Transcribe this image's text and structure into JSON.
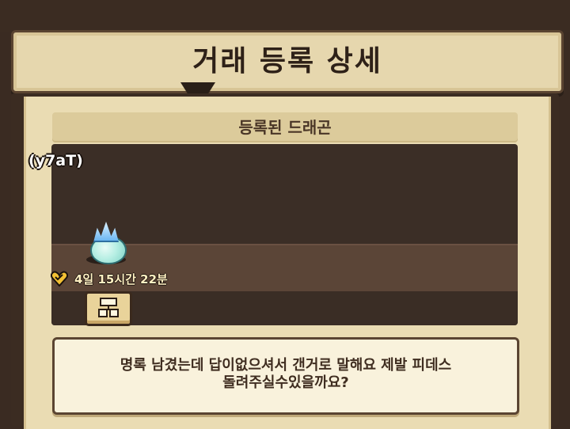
{
  "header": {
    "title": "거래 등록 상세"
  },
  "section": {
    "title": "등록된 드래곤"
  },
  "dragon": {
    "owner_name": "(y7aT)",
    "timer": "4일 15시간 22분",
    "item_icon": "dragon-egg-icon"
  },
  "message": {
    "line1": "명록 남겼는데 답이없으셔서 갠거로 말해요 제발 피데스",
    "line2": "돌려주실수있을까요?"
  },
  "icons": {
    "timer_icon": "heart-icon",
    "button_icon": "tree-chart-icon"
  },
  "colors": {
    "panel": "#eadcb3",
    "frame": "#3b2c22",
    "text_dark": "#2e2118"
  }
}
